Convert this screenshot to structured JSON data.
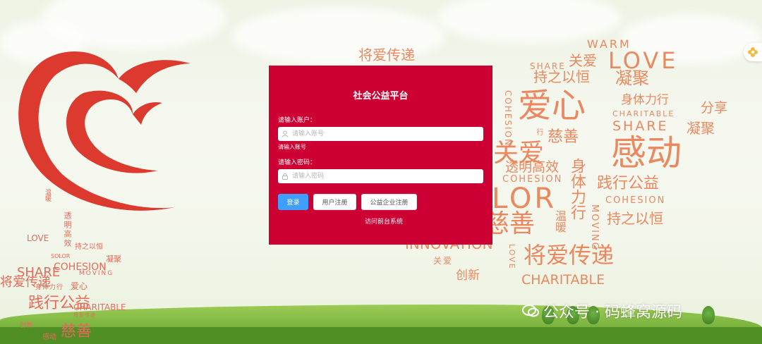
{
  "login": {
    "title": "社会公益平台",
    "account_label": "请输入账户：",
    "account_placeholder": "请输入账号",
    "account_error": "请输入账号",
    "password_label": "请输入密码：",
    "password_placeholder": "请输入密码",
    "login_button": "登录",
    "user_register_button": "用户注册",
    "enterprise_register_button": "公益企业注册",
    "frontend_link": "访问前台系统"
  },
  "background": {
    "words": [
      "WARM",
      "SHARE",
      "关爱",
      "LOVE",
      "将爱传递",
      "爱心",
      "持之以恒",
      "凝聚",
      "身体力行",
      "CHARITABLE",
      "分享",
      "COHESION",
      "SHARE",
      "慈善",
      "凝聚",
      "感动",
      "透明高效",
      "身体力行",
      "COHESION",
      "践行公益",
      "COHESION",
      "LOR",
      "慈善",
      "温暖",
      "MOVING",
      "持之以恒",
      "INNOVATION",
      "关爱",
      "将爱传递",
      "创新",
      "CHARITABLE",
      "LOVE",
      "行",
      "关爱",
      "SHARE",
      "温暖",
      "将爱传递",
      "LOVE",
      "透明高效",
      "持之以恒",
      "COHESION",
      "SOLOR",
      "MOVING",
      "身体力行",
      "爱心",
      "践行公益",
      "CHARITABLE",
      "将爱传递",
      "创新",
      "感动",
      "慈善",
      "凝聚"
    ],
    "watermark": "公众号 · 码蜂窝源码"
  },
  "colors": {
    "panel": "#cc0033",
    "primary_button": "#409eff",
    "word": "#ea8860",
    "heart": "#dc3a2e"
  },
  "icons": {
    "account": "user-icon",
    "password": "lock-icon",
    "corner": "flower-icon",
    "logo": "heart-logo"
  }
}
